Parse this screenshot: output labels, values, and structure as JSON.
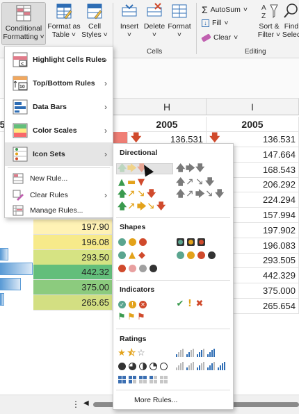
{
  "ribbon": {
    "conditional_formatting": "Conditional Formatting",
    "cf_line1": "Conditional",
    "cf_line2": "Formatting",
    "format_as_table_1": "Format as",
    "format_as_table_2": "Table",
    "cell_styles_1": "Cell",
    "cell_styles_2": "Styles",
    "insert": "Insert",
    "delete": "Delete",
    "format": "Format",
    "cells_group": "Cells",
    "autosum": "AutoSum",
    "fill": "Fill",
    "clear": "Clear",
    "sort_filter_1": "Sort &",
    "sort_filter_2": "Filter",
    "find_select_1": "Find",
    "find_select_2": "Selec",
    "editing_group": "Editing"
  },
  "grid": {
    "columns": [
      "H",
      "I"
    ],
    "header_year_left": "5",
    "header_year_g": "2005",
    "header_year_h": "2005",
    "header_year_i": "2005",
    "h_row1": "136.531",
    "i_values": [
      "136.531",
      "147.664",
      "168.543",
      "206.292",
      "224.294",
      "157.994",
      "197.902",
      "196.083",
      "293.505",
      "442.329",
      "375.000",
      "265.654"
    ],
    "f_values": [
      "197.90",
      "196.08",
      "293.50",
      "442.32",
      "375.00",
      "265.65"
    ]
  },
  "cf_menu": {
    "items": [
      {
        "label": "Highlight Cells Rules",
        "icon": "highlight-cells-icon"
      },
      {
        "label": "Top/Bottom Rules",
        "icon": "top-bottom-icon"
      },
      {
        "label": "Data Bars",
        "icon": "data-bars-icon"
      },
      {
        "label": "Color Scales",
        "icon": "color-scales-icon"
      },
      {
        "label": "Icon Sets",
        "icon": "icon-sets-icon"
      }
    ],
    "new_rule": "New Rule...",
    "clear_rules": "Clear Rules",
    "manage_rules": "Manage Rules..."
  },
  "icon_sets": {
    "directional": "Directional",
    "shapes": "Shapes",
    "indicators": "Indicators",
    "ratings": "Ratings",
    "more_rules": "More Rules..."
  },
  "colors": {
    "green": "#3a9a4e",
    "yellow": "#e3a21a",
    "red": "#d04a2c",
    "gray": "#7a7a7a",
    "blue": "#2e6db4"
  }
}
